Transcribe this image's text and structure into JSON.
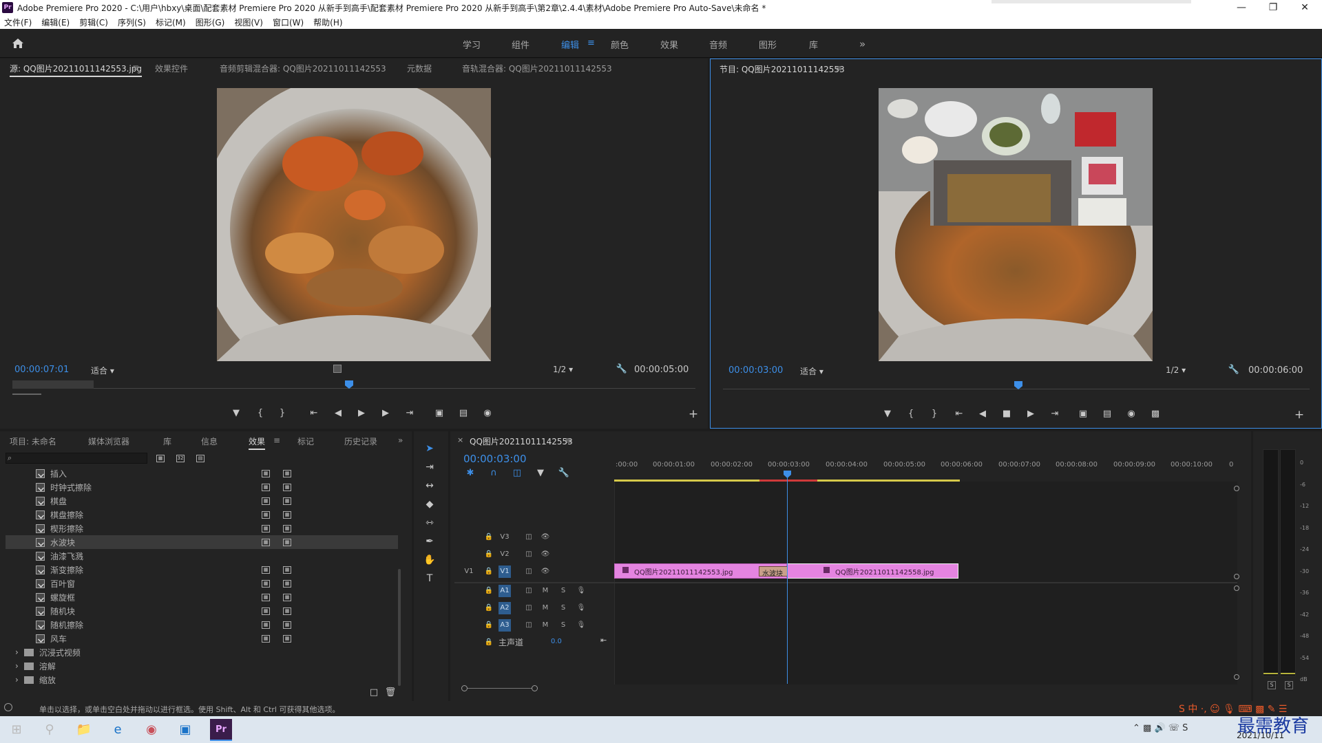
{
  "window": {
    "title": "Adobe Premiere Pro 2020 - C:\\用户\\hbxy\\桌面\\配套素材 Premiere Pro 2020 从新手到高手\\配套素材 Premiere Pro 2020 从新手到高手\\第2章\\2.4.4\\素材\\Adobe Premiere Pro Auto-Save\\未命名 *",
    "logo": "Pr"
  },
  "menu": [
    "文件(F)",
    "编辑(E)",
    "剪辑(C)",
    "序列(S)",
    "标记(M)",
    "图形(G)",
    "视图(V)",
    "窗口(W)",
    "帮助(H)"
  ],
  "workspaces": {
    "items": [
      "学习",
      "组件",
      "编辑",
      "颜色",
      "效果",
      "音频",
      "图形",
      "库"
    ],
    "active": "编辑",
    "more": "»"
  },
  "source_panel": {
    "tabs": [
      "源: QQ图片20211011142553.jpg",
      "效果控件",
      "音频剪辑混合器: QQ图片20211011142553",
      "元数据",
      "音轨混合器: QQ图片20211011142553"
    ],
    "timecode": "00:00:07:01",
    "fit": "适合",
    "resolution": "1/2",
    "duration": "00:00:05:00"
  },
  "program_panel": {
    "tab": "节目: QQ图片20211011142553",
    "timecode": "00:00:03:00",
    "fit": "适合",
    "resolution": "1/2",
    "duration": "00:00:06:00"
  },
  "project_panel": {
    "tabs": [
      "项目: 未命名",
      "媒体浏览器",
      "库",
      "信息",
      "效果",
      "标记",
      "历史记录"
    ],
    "active_tab": "效果",
    "search_icon": "⌕",
    "effects": [
      "插入",
      "时钟式擦除",
      "棋盘",
      "棋盘擦除",
      "楔形擦除",
      "水波块",
      "油漆飞溅",
      "渐变擦除",
      "百叶窗",
      "螺旋框",
      "随机块",
      "随机擦除",
      "风车"
    ],
    "selected": "水波块",
    "folders": [
      "沉浸式视频",
      "溶解",
      "缩放"
    ]
  },
  "timeline": {
    "tab": "QQ图片20211011142553",
    "timecode": "00:00:03:00",
    "ruler": [
      ":00:00",
      "00:00:01:00",
      "00:00:02:00",
      "00:00:03:00",
      "00:00:04:00",
      "00:00:05:00",
      "00:00:06:00",
      "00:00:07:00",
      "00:00:08:00",
      "00:00:09:00",
      "00:00:10:00",
      "0"
    ],
    "tracks": {
      "video": [
        {
          "label": "V3",
          "src": ""
        },
        {
          "label": "V2",
          "src": ""
        },
        {
          "label": "V1",
          "src": "V1"
        }
      ],
      "audio": [
        {
          "label": "A1",
          "m": "M",
          "s": "S"
        },
        {
          "label": "A2",
          "m": "M",
          "s": "S"
        },
        {
          "label": "A3",
          "m": "M",
          "s": "S"
        }
      ],
      "master": "主声道",
      "master_value": "0.0"
    },
    "clips": [
      {
        "label": "QQ图片20211011142553.jpg"
      },
      {
        "label": "水波块"
      },
      {
        "label": "QQ图片20211011142558.jpg"
      }
    ]
  },
  "audio_meter": {
    "scale": [
      "0",
      "-6",
      "-12",
      "-18",
      "-24",
      "-30",
      "-36",
      "-42",
      "-48",
      "-54",
      "dB"
    ],
    "solo": [
      "S",
      "S"
    ]
  },
  "status_bar": {
    "text": "单击以选择，或单击空白处并拖动以进行框选。使用 Shift、Alt 和 Ctrl 可获得其他选项。"
  },
  "taskbar": {
    "date": "2021/10/11",
    "watermark": "最需教育"
  },
  "colors": {
    "accent": "#3d8fe8",
    "clip": "#e484e0",
    "transition": "#c9a08a",
    "bg": "#232323"
  }
}
